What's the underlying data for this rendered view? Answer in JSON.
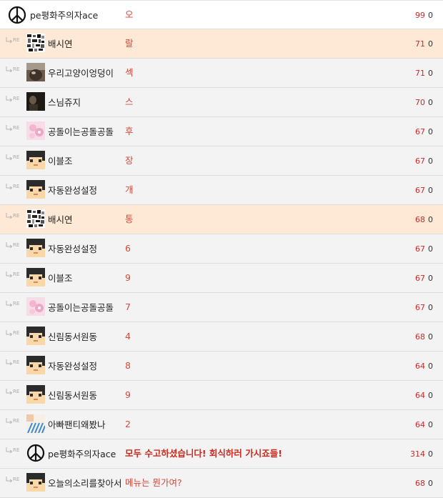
{
  "reply_marker": "RE",
  "rows": [
    {
      "kind": "top",
      "avatar": "peace-icon",
      "nick": "pe평화주의자ace",
      "content": "오",
      "score": "99",
      "count": "0",
      "highlight": false,
      "bold": false
    },
    {
      "kind": "reply",
      "avatar": "glitch-avatar",
      "nick": "배시연",
      "content": "랄",
      "score": "71",
      "count": "0",
      "highlight": true,
      "bold": false
    },
    {
      "kind": "reply",
      "avatar": "cat-photo-avatar",
      "nick": "우리고양이엉덩이",
      "content": "섹",
      "score": "71",
      "count": "0",
      "highlight": false,
      "bold": false
    },
    {
      "kind": "reply",
      "avatar": "dark-photo-avatar",
      "nick": "스님쥬지",
      "content": "스",
      "score": "70",
      "count": "0",
      "highlight": false,
      "bold": false
    },
    {
      "kind": "reply",
      "avatar": "pink-flower-avatar",
      "nick": "공돌이는공돌공돌",
      "content": "후",
      "score": "67",
      "count": "0",
      "highlight": false,
      "bold": false
    },
    {
      "kind": "reply",
      "avatar": "pixel-face-avatar",
      "nick": "이블조",
      "content": "장",
      "score": "67",
      "count": "0",
      "highlight": false,
      "bold": false
    },
    {
      "kind": "reply",
      "avatar": "pixel-face-avatar",
      "nick": "자동완성설정",
      "content": "개",
      "score": "67",
      "count": "0",
      "highlight": false,
      "bold": false
    },
    {
      "kind": "reply",
      "avatar": "glitch-avatar",
      "nick": "배시연",
      "content": "통",
      "score": "68",
      "count": "0",
      "highlight": true,
      "bold": false
    },
    {
      "kind": "reply",
      "avatar": "pixel-face-avatar",
      "nick": "자동완성설정",
      "content": "6",
      "score": "67",
      "count": "0",
      "highlight": false,
      "bold": false
    },
    {
      "kind": "reply",
      "avatar": "pixel-face-avatar",
      "nick": "이블조",
      "content": "9",
      "score": "67",
      "count": "0",
      "highlight": false,
      "bold": false
    },
    {
      "kind": "reply",
      "avatar": "pink-flower-avatar",
      "nick": "공돌이는공돌공돌",
      "content": "7",
      "score": "67",
      "count": "0",
      "highlight": false,
      "bold": false
    },
    {
      "kind": "reply",
      "avatar": "pixel-face-avatar",
      "nick": "신림동서원동",
      "content": "4",
      "score": "68",
      "count": "0",
      "highlight": false,
      "bold": false
    },
    {
      "kind": "reply",
      "avatar": "pixel-face-avatar",
      "nick": "자동완성설정",
      "content": "8",
      "score": "64",
      "count": "0",
      "highlight": false,
      "bold": false
    },
    {
      "kind": "reply",
      "avatar": "pixel-face-avatar",
      "nick": "신림동서원동",
      "content": "9",
      "score": "64",
      "count": "0",
      "highlight": false,
      "bold": false
    },
    {
      "kind": "reply",
      "avatar": "blue-pattern-avatar",
      "nick": "아빠팬티왜봤나",
      "content": "2",
      "score": "64",
      "count": "0",
      "highlight": false,
      "bold": false
    },
    {
      "kind": "reply",
      "avatar": "peace-icon",
      "nick": "pe평화주의자ace",
      "content": "모두 수고하셨습니다! 회식하러 가시죠들!",
      "score": "314",
      "count": "0",
      "highlight": false,
      "bold": true
    },
    {
      "kind": "reply",
      "avatar": "pixel-face-avatar",
      "nick": "오늘의소리를찾아서",
      "content": "메뉴는 뭔가여?",
      "score": "68",
      "count": "0",
      "highlight": false,
      "bold": false
    }
  ],
  "colors": {
    "highlight_row": "#fde9d6",
    "row": "#f3f3f3",
    "content_text": "#d24a3c",
    "score_text": "#cc2a2a"
  }
}
